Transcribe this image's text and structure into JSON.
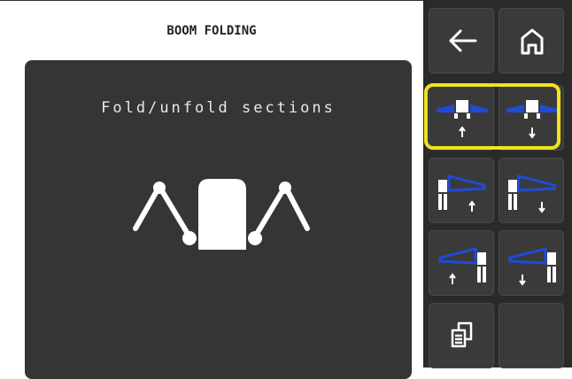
{
  "header": {
    "title": "BOOM FOLDING"
  },
  "panel": {
    "title": "Fold/unfold sections",
    "illustration_icon": "boom-arms-icon"
  },
  "sidebar": {
    "buttons": [
      {
        "name": "back-button",
        "icon": "arrow-left-icon"
      },
      {
        "name": "home-button",
        "icon": "home-icon"
      },
      {
        "name": "fold-all-up-button",
        "icon": "boom-both-up-icon"
      },
      {
        "name": "fold-all-down-button",
        "icon": "boom-both-down-icon"
      },
      {
        "name": "fold-left-up-button",
        "icon": "boom-left-up-icon"
      },
      {
        "name": "fold-left-down-button",
        "icon": "boom-left-down-icon"
      },
      {
        "name": "fold-right-up-button",
        "icon": "boom-right-up-icon"
      },
      {
        "name": "fold-right-down-button",
        "icon": "boom-right-down-icon"
      },
      {
        "name": "copy-button",
        "icon": "copy-icon"
      },
      {
        "name": "empty-button",
        "icon": ""
      }
    ]
  },
  "colors": {
    "accent_blue": "#1f4bd6",
    "highlight": "#f2e21c",
    "panel_bg": "#353535",
    "sidebar_bg": "#2a2a2a"
  }
}
